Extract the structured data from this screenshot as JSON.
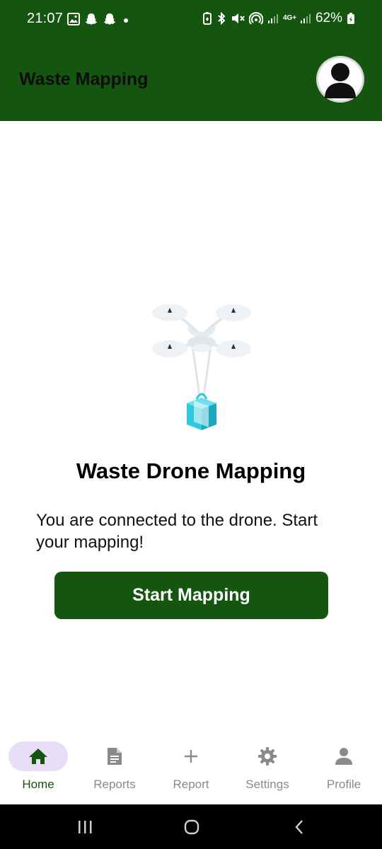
{
  "status_bar": {
    "time": "21:07",
    "battery_percent": "62%",
    "left_icons": [
      "image-icon",
      "snapchat-icon",
      "snapchat-icon",
      "dot-icon"
    ],
    "right_icons": [
      "battery-saver-icon",
      "bluetooth-icon",
      "mute-icon",
      "hotspot-icon",
      "signal-icon",
      "4g-icon",
      "signal-icon",
      "battery-icon"
    ],
    "network_label": "4G+"
  },
  "app_bar": {
    "title": "Waste Mapping",
    "avatar_icon": "person-icon"
  },
  "main": {
    "illustration": "drone-with-package-icon",
    "headline": "Waste Drone Mapping",
    "message": "You are connected to the drone. Start your mapping!",
    "primary_button": "Start Mapping"
  },
  "bottom_nav": {
    "items": [
      {
        "label": "Home",
        "icon": "home-icon",
        "active": true
      },
      {
        "label": "Reports",
        "icon": "document-icon",
        "active": false
      },
      {
        "label": "Report",
        "icon": "plus-icon",
        "active": false
      },
      {
        "label": "Settings",
        "icon": "gear-icon",
        "active": false
      },
      {
        "label": "Profile",
        "icon": "person-icon",
        "active": false
      }
    ]
  },
  "system_nav": {
    "buttons": [
      "recent-apps-icon",
      "home-circle-icon",
      "back-icon"
    ]
  },
  "colors": {
    "brand": "#14560f",
    "active_pill": "#e8def8",
    "inactive_nav": "#8a8a8a"
  }
}
